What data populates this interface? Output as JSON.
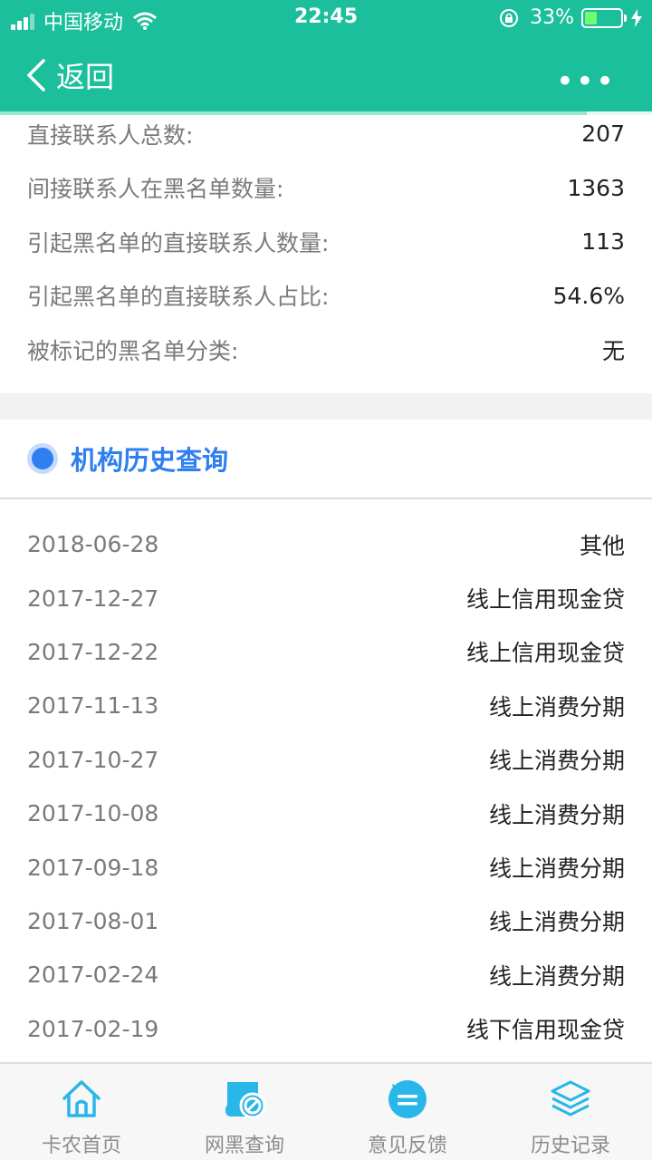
{
  "status": {
    "carrier": "中国移动",
    "time": "22:45",
    "battery": "33%",
    "battery_level": 0.33
  },
  "nav": {
    "back_label": "返回",
    "more_label": "•••",
    "load_progress": 0.9
  },
  "info_rows": [
    {
      "label": "直接联系人总数:",
      "value": "207"
    },
    {
      "label": "间接联系人在黑名单数量:",
      "value": "1363"
    },
    {
      "label": "引起黑名单的直接联系人数量:",
      "value": "113"
    },
    {
      "label": "引起黑名单的直接联系人占比:",
      "value": "54.6%"
    },
    {
      "label": "被标记的黑名单分类:",
      "value": "无"
    }
  ],
  "section": {
    "title": "机构历史查询"
  },
  "history": [
    {
      "date": "2018-06-28",
      "type": "其他"
    },
    {
      "date": "2017-12-27",
      "type": "线上信用现金贷"
    },
    {
      "date": "2017-12-22",
      "type": "线上信用现金贷"
    },
    {
      "date": "2017-11-13",
      "type": "线上消费分期"
    },
    {
      "date": "2017-10-27",
      "type": "线上消费分期"
    },
    {
      "date": "2017-10-08",
      "type": "线上消费分期"
    },
    {
      "date": "2017-09-18",
      "type": "线上消费分期"
    },
    {
      "date": "2017-08-01",
      "type": "线上消费分期"
    },
    {
      "date": "2017-02-24",
      "type": "线上消费分期"
    },
    {
      "date": "2017-02-19",
      "type": "线下信用现金贷"
    }
  ],
  "tabs": [
    {
      "label": "卡农首页",
      "icon": "home-icon"
    },
    {
      "label": "网黑查询",
      "icon": "blacklist-query-icon"
    },
    {
      "label": "意见反馈",
      "icon": "feedback-icon"
    },
    {
      "label": "历史记录",
      "icon": "history-layers-icon"
    }
  ],
  "colors": {
    "header": "#1bbf9b",
    "accent_blue": "#2f7ff0",
    "tab_icon": "#29b6e8"
  }
}
